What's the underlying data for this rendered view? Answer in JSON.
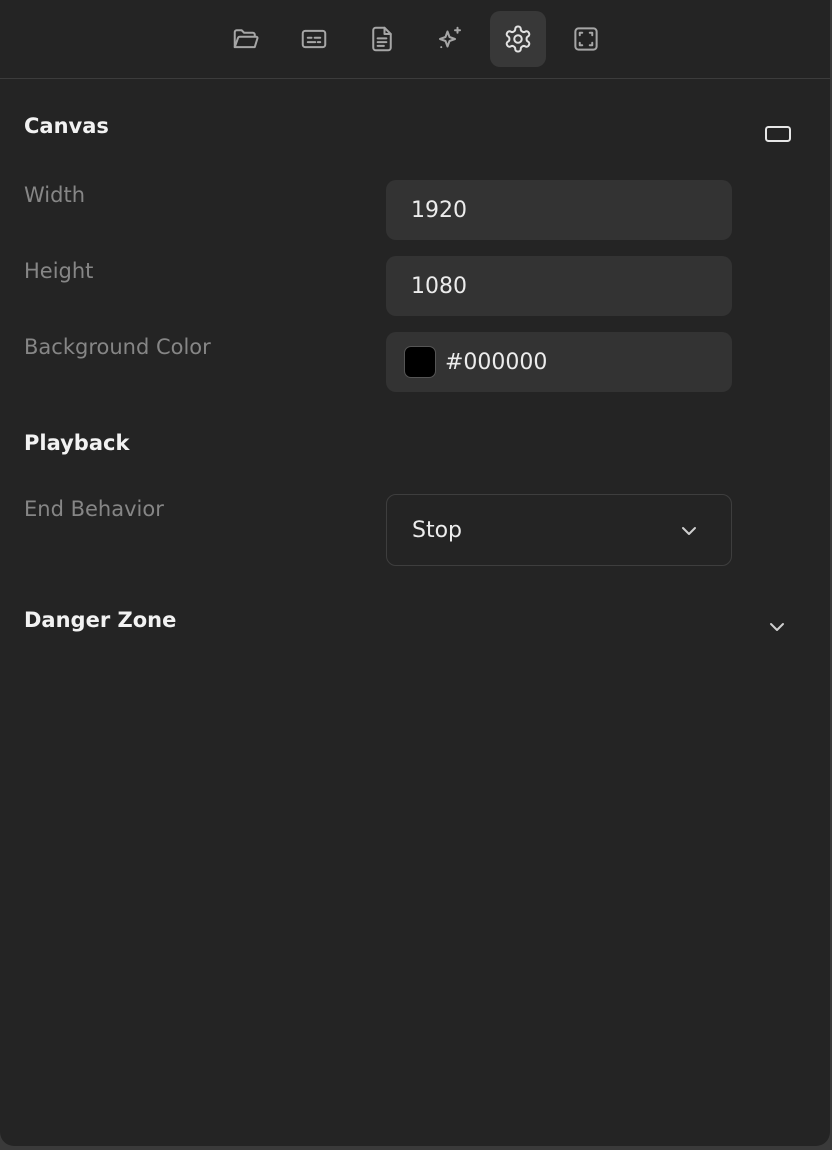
{
  "toolbar": {
    "tools": [
      {
        "icon": "folder-open-icon"
      },
      {
        "icon": "captions-icon"
      },
      {
        "icon": "document-icon"
      },
      {
        "icon": "sparkles-icon"
      },
      {
        "icon": "gear-icon",
        "active": true
      },
      {
        "icon": "frame-corners-icon"
      }
    ]
  },
  "canvas": {
    "title": "Canvas",
    "aspect_icon": "aspect-ratio-icon",
    "width_label": "Width",
    "width_value": "1920",
    "height_label": "Height",
    "height_value": "1080",
    "bg_label": "Background Color",
    "bg_value": "#000000",
    "bg_swatch_color": "#000000"
  },
  "playback": {
    "title": "Playback",
    "end_behavior_label": "End Behavior",
    "end_behavior_value": "Stop"
  },
  "danger_zone": {
    "title": "Danger Zone",
    "expanded": false
  }
}
